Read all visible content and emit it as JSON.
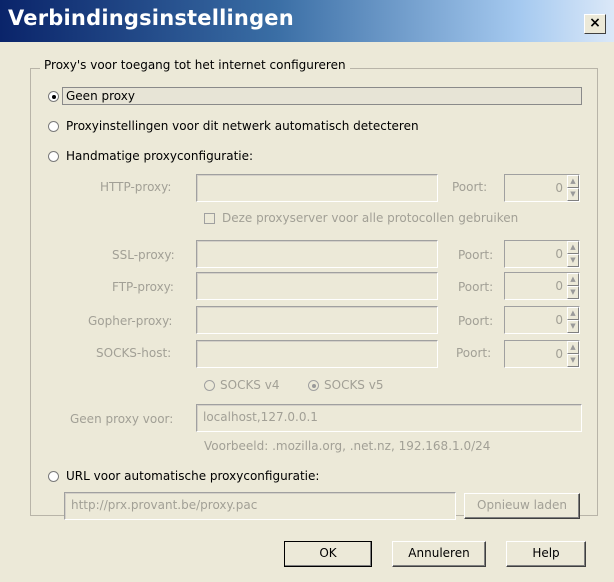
{
  "window": {
    "title": "Verbindingsinstellingen",
    "close_label": "×"
  },
  "group": {
    "legend": "Proxy's voor toegang tot het internet configureren"
  },
  "options": {
    "no_proxy": "Geen proxy",
    "auto_detect": "Proxyinstellingen voor dit netwerk automatisch detecteren",
    "manual": "Handmatige proxyconfiguratie:",
    "auto_url": "URL voor automatische proxyconfiguratie:"
  },
  "selected_option": "no_proxy",
  "proxies": [
    {
      "label": "HTTP-proxy:",
      "host": "",
      "port_label": "Poort:",
      "port": "0"
    },
    {
      "label": "SSL-proxy:",
      "host": "",
      "port_label": "Poort:",
      "port": "0"
    },
    {
      "label": "FTP-proxy:",
      "host": "",
      "port_label": "Poort:",
      "port": "0"
    },
    {
      "label": "Gopher-proxy:",
      "host": "",
      "port_label": "Poort:",
      "port": "0"
    },
    {
      "label": "SOCKS-host:",
      "host": "",
      "port_label": "Poort:",
      "port": "0"
    }
  ],
  "same_proxy_checkbox": "Deze proxyserver voor alle protocollen gebruiken",
  "socks": {
    "v4": "SOCKS v4",
    "v5": "SOCKS v5",
    "selected": "v5"
  },
  "no_proxy_for": {
    "label": "Geen proxy voor:",
    "value": "localhost,127.0.0.1",
    "example": "Voorbeeld: .mozilla.org, .net.nz, 192.168.1.0/24"
  },
  "pac": {
    "url": "http://prx.provant.be/proxy.pac",
    "reload_label": "Opnieuw laden"
  },
  "buttons": {
    "ok": "OK",
    "cancel": "Annuleren",
    "help": "Help"
  }
}
